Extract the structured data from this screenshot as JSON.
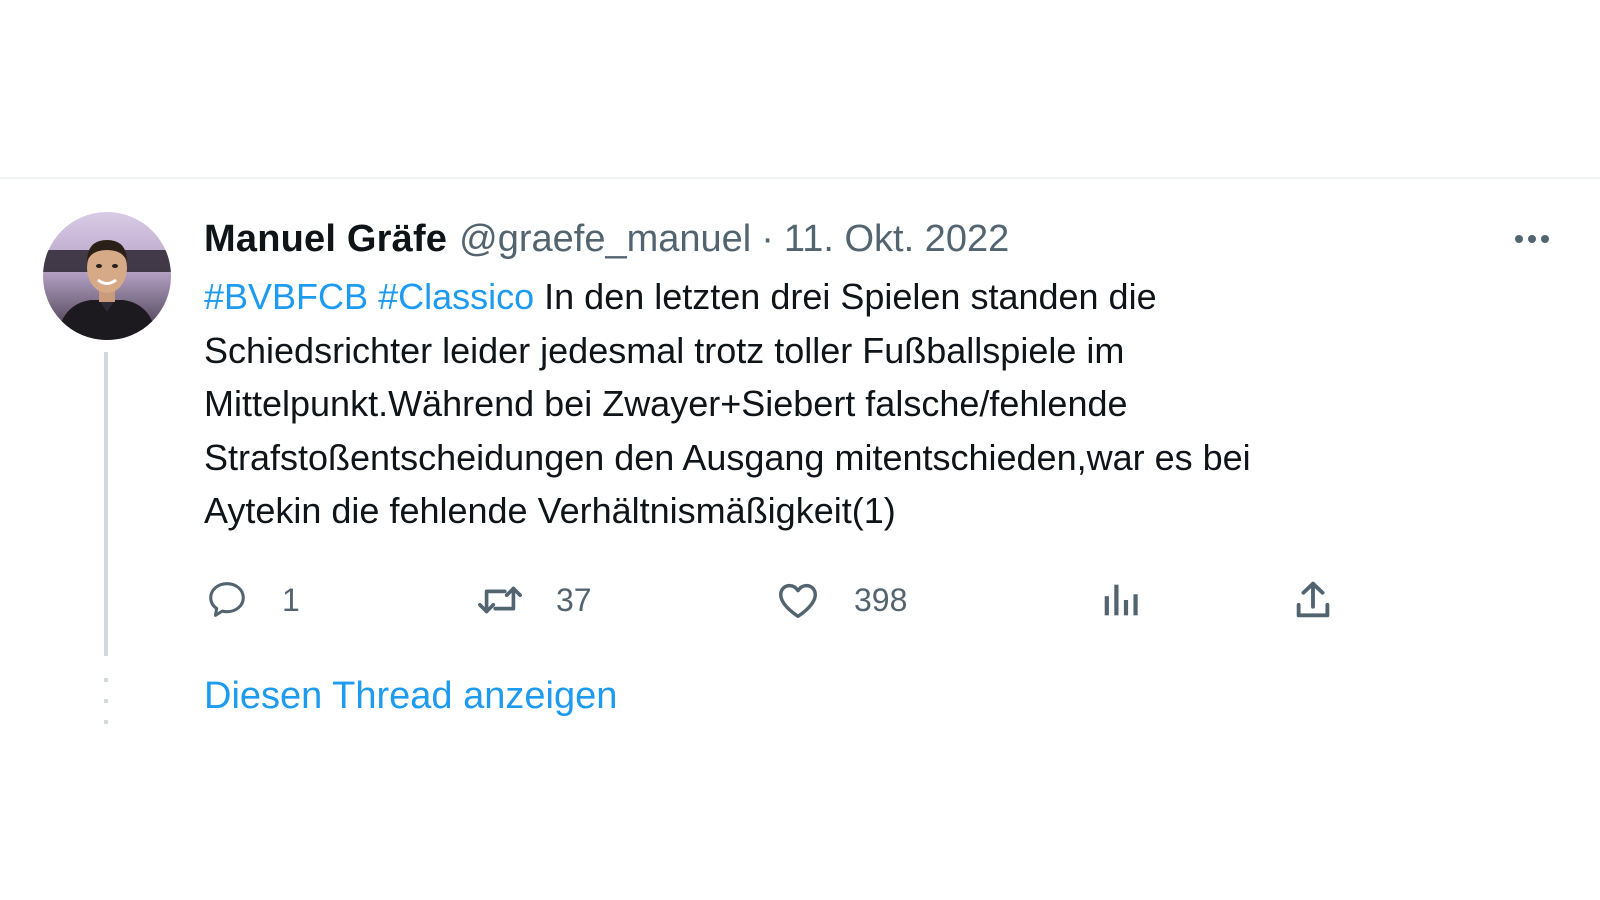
{
  "tweet": {
    "author_name": "Manuel Gräfe",
    "handle": "@graefe_manuel",
    "separator": "·",
    "date": "11. Okt. 2022",
    "hashtags": [
      "#BVBFCB",
      "#Classico"
    ],
    "text_lines": [
      "In den letzten drei Spielen standen die",
      "Schiedsrichter leider jedesmal trotz toller Fußballspiele im",
      "Mittelpunkt.Während bei Zwayer+Siebert falsche/fehlende",
      "Strafstoßentscheidungen den Ausgang mitentschieden,war es bei",
      "Aytekin die fehlende Verhältnismäßigkeit(1)"
    ],
    "actions": {
      "replies": "1",
      "retweets": "37",
      "likes": "398"
    },
    "show_thread_label": "Diesen Thread anzeigen"
  },
  "icons": {
    "reply": "speech-bubble-icon",
    "retweet": "retweet-arrows-icon",
    "like": "heart-icon",
    "views": "bar-chart-icon",
    "share": "share-upload-icon",
    "more": "more-horizontal-icon"
  },
  "colors": {
    "accent": "#1d9bf0",
    "text_primary": "#0f1419",
    "text_secondary": "#536471",
    "thread_line": "#cfd9de",
    "divider": "#eff3f4"
  }
}
